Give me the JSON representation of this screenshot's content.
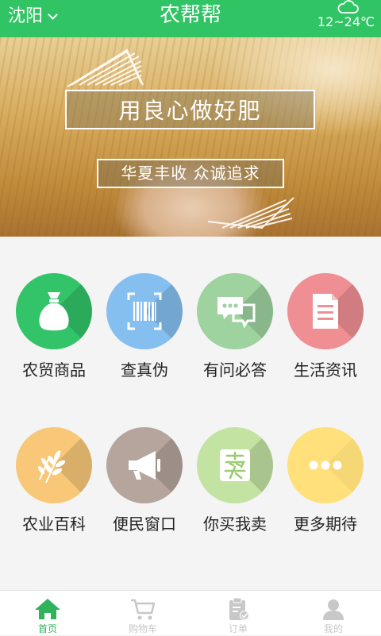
{
  "header": {
    "city": "沈阳",
    "title": "农帮帮",
    "weather_icon": "cloud-icon",
    "temperature": "12~24℃"
  },
  "banner": {
    "slogan_main": "用良心做好肥",
    "slogan_sub": "华夏丰收  众诚追求"
  },
  "menu": [
    {
      "label": "农贸商品",
      "icon": "money-bag-icon",
      "color": "#33c46a"
    },
    {
      "label": "查真伪",
      "icon": "barcode-scan-icon",
      "color": "#85bff0"
    },
    {
      "label": "有问必答",
      "icon": "chat-bubbles-icon",
      "color": "#9ed3a0"
    },
    {
      "label": "生活资讯",
      "icon": "document-icon",
      "color": "#ef8f93"
    },
    {
      "label": "农业百科",
      "icon": "wheat-icon",
      "color": "#f8c878"
    },
    {
      "label": "便民窗口",
      "icon": "megaphone-icon",
      "color": "#b5a59d"
    },
    {
      "label": "你买我卖",
      "icon": "sell-icon",
      "color": "#c3e3a3"
    },
    {
      "label": "更多期待",
      "icon": "more-dots-icon",
      "color": "#ffe07a"
    }
  ],
  "tabbar": [
    {
      "label": "首页",
      "icon": "home-icon",
      "active": true,
      "color": "#2fb35c"
    },
    {
      "label": "购物车",
      "icon": "cart-icon",
      "active": false,
      "color": "#c8c8c8"
    },
    {
      "label": "订单",
      "icon": "clipboard-check-icon",
      "active": false,
      "color": "#c8c8c8"
    },
    {
      "label": "我的",
      "icon": "user-icon",
      "active": false,
      "color": "#c8c8c8"
    }
  ]
}
